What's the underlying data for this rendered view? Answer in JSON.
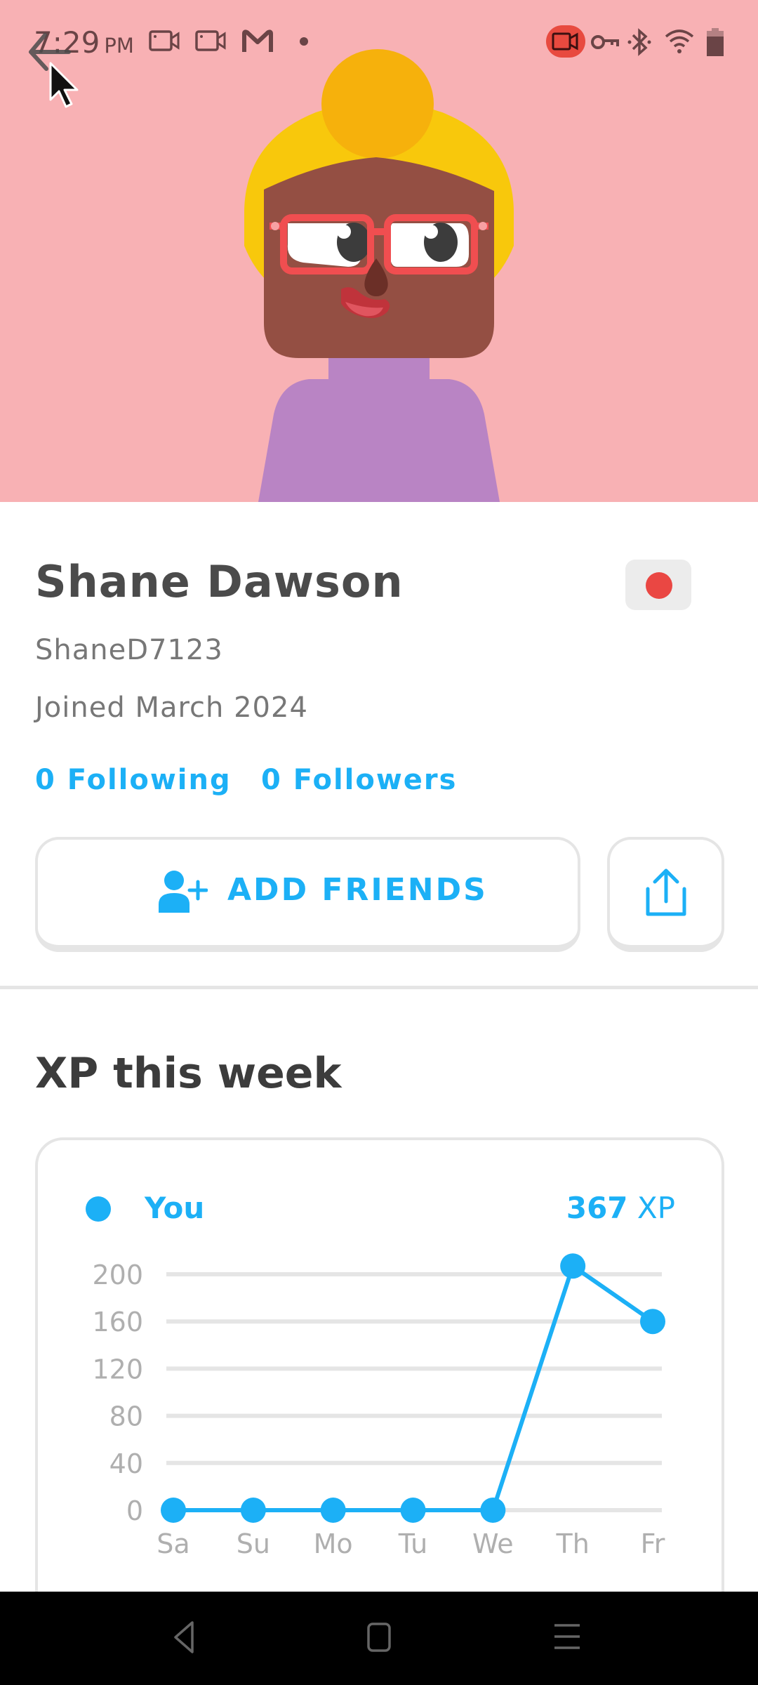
{
  "status_bar": {
    "time": "7:29",
    "ampm": "PM",
    "left_icons": [
      "video-camera-icon",
      "video-camera-icon",
      "gmail-icon",
      "notification-dot-icon"
    ],
    "right_icons": [
      "screen-record-icon",
      "vpn-key-icon",
      "bluetooth-icon",
      "wifi-icon",
      "battery-icon"
    ]
  },
  "hero": {
    "background_color": "#f8b1b4",
    "back_icon": "back-arrow-icon"
  },
  "profile": {
    "name": "Shane Dawson",
    "username": "ShaneD7123",
    "joined": "Joined March 2024",
    "following_label": "0 Following",
    "followers_label": "0 Followers",
    "flag_icon": "country-flag-japan-icon"
  },
  "actions": {
    "add_friends_label": "ADD FRIENDS",
    "add_friends_icon": "add-user-icon",
    "share_icon": "share-icon"
  },
  "xp_section": {
    "title": "XP this week",
    "legend_label": "You",
    "total_number": "367",
    "total_unit": "XP"
  },
  "chart_data": {
    "type": "line",
    "title": "XP this week",
    "xlabel": "",
    "ylabel": "",
    "categories": [
      "Sa",
      "Su",
      "Mo",
      "Tu",
      "We",
      "Th",
      "Fr"
    ],
    "series": [
      {
        "name": "You",
        "values": [
          0,
          0,
          0,
          0,
          0,
          207,
          160
        ],
        "color": "#1cb0f6"
      }
    ],
    "yticks": [
      0,
      40,
      80,
      120,
      160,
      200
    ],
    "ylim": [
      0,
      200
    ],
    "grid": true,
    "legend": "top-left"
  },
  "colors": {
    "accent": "#1cb0f6",
    "text_dark": "#4b4b4b",
    "text_muted": "#777777",
    "border": "#e5e5e5"
  },
  "nav_bar": {
    "icons": [
      "nav-back-icon",
      "nav-home-icon",
      "nav-recents-icon"
    ]
  }
}
